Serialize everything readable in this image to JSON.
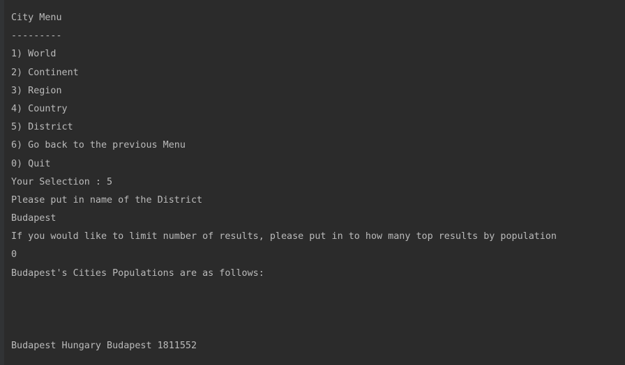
{
  "console": {
    "lines": [
      "City Menu",
      "---------",
      "1) World",
      "2) Continent",
      "3) Region",
      "4) Country",
      "5) District",
      "6) Go back to the previous Menu",
      "0) Quit",
      "Your Selection : 5",
      "Please put in name of the District",
      "Budapest",
      "If you would like to limit number of results, please put in to how many top results by population",
      "0",
      "Budapest's Cities Populations are as follows:",
      "",
      "",
      "",
      "Budapest Hungary Budapest 1811552"
    ]
  },
  "colors": {
    "background": "#2b2b2b",
    "text": "#bbbbbb",
    "gutter": "#313335"
  }
}
